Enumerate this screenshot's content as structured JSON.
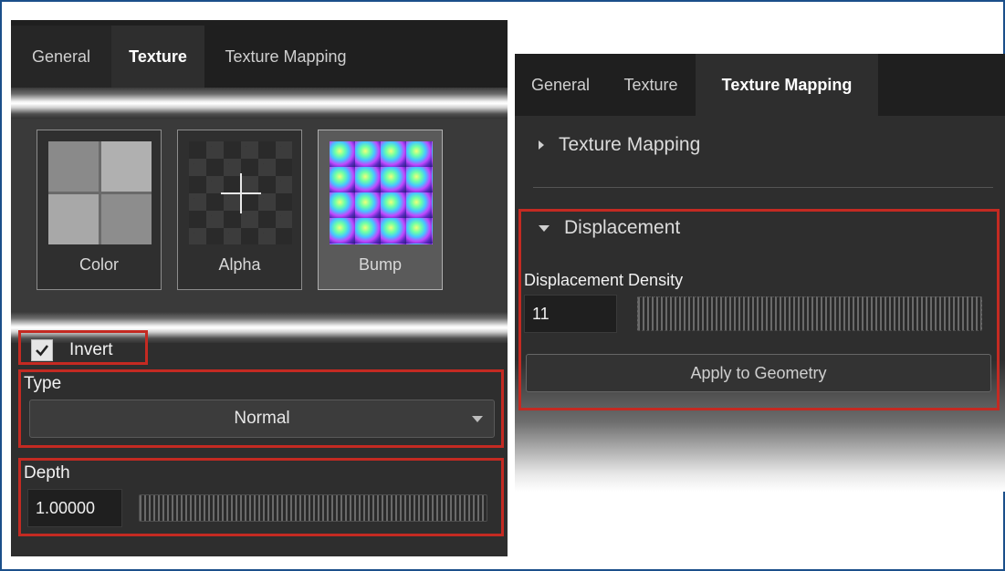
{
  "left_panel": {
    "tabs": [
      {
        "label": "General",
        "active": false
      },
      {
        "label": "Texture",
        "active": true
      },
      {
        "label": "Texture Mapping",
        "active": false
      }
    ],
    "swatches": [
      {
        "label": "Color",
        "icon": "color-swatch-icon",
        "selected": false
      },
      {
        "label": "Alpha",
        "icon": "add-alpha-icon",
        "selected": false
      },
      {
        "label": "Bump",
        "icon": "bump-map-icon",
        "selected": true
      }
    ],
    "invert": {
      "label": "Invert",
      "checked": true
    },
    "type": {
      "label": "Type",
      "value": "Normal"
    },
    "depth": {
      "label": "Depth",
      "value": "1.00000"
    }
  },
  "right_panel": {
    "tabs": [
      {
        "label": "General",
        "active": false
      },
      {
        "label": "Texture",
        "active": false
      },
      {
        "label": "Texture Mapping",
        "active": true
      }
    ],
    "texture_mapping_section": {
      "label": "Texture Mapping",
      "expanded": false
    },
    "displacement_section": {
      "label": "Displacement",
      "expanded": true
    },
    "displacement_density": {
      "label": "Displacement Density",
      "value": "11"
    },
    "apply_button": "Apply to Geometry"
  },
  "colors": {
    "highlight_border": "#c42a22",
    "panel_bg": "#2e2e2e",
    "tabbar_bg": "#1f1f1f",
    "frame_border": "#1b4f8a"
  }
}
